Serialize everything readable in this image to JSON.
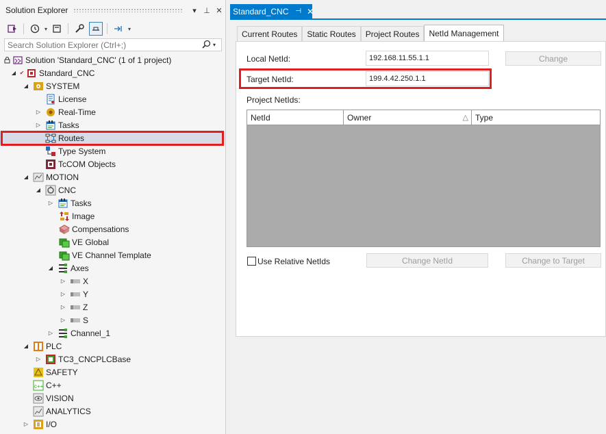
{
  "solution_explorer": {
    "title": "Solution Explorer",
    "title_buttons": [
      "▾",
      "⊥",
      "✕"
    ],
    "search": {
      "placeholder": "Search Solution Explorer (Ctrl+;)"
    },
    "tree": [
      {
        "label": "Solution 'Standard_CNC' (1 of 1 project)",
        "icon": "solution-icon"
      },
      {
        "label": "Standard_CNC",
        "icon": "project-icon"
      },
      {
        "label": "SYSTEM",
        "icon": "system-icon"
      },
      {
        "label": "License",
        "icon": "license-icon"
      },
      {
        "label": "Real-Time",
        "icon": "realtime-icon"
      },
      {
        "label": "Tasks",
        "icon": "tasks-icon"
      },
      {
        "label": "Routes",
        "icon": "routes-icon"
      },
      {
        "label": "Type System",
        "icon": "type-system-icon"
      },
      {
        "label": "TcCOM Objects",
        "icon": "tccom-icon"
      },
      {
        "label": "MOTION",
        "icon": "motion-icon"
      },
      {
        "label": "CNC",
        "icon": "cnc-icon"
      },
      {
        "label": "Tasks",
        "icon": "tasks-icon"
      },
      {
        "label": "Image",
        "icon": "image-icon"
      },
      {
        "label": "Compensations",
        "icon": "compensations-icon"
      },
      {
        "label": "VE Global",
        "icon": "ve-icon"
      },
      {
        "label": "VE Channel Template",
        "icon": "ve-icon"
      },
      {
        "label": "Axes",
        "icon": "axes-icon"
      },
      {
        "label": "X",
        "icon": "axis-icon"
      },
      {
        "label": "Y",
        "icon": "axis-icon"
      },
      {
        "label": "Z",
        "icon": "axis-icon"
      },
      {
        "label": "S",
        "icon": "axis-icon"
      },
      {
        "label": "Channel_1",
        "icon": "channel-icon"
      },
      {
        "label": "PLC",
        "icon": "plc-icon"
      },
      {
        "label": "TC3_CNCPLCBase",
        "icon": "plc-project-icon"
      },
      {
        "label": "SAFETY",
        "icon": "safety-icon"
      },
      {
        "label": "C++",
        "icon": "cpp-icon"
      },
      {
        "label": "VISION",
        "icon": "vision-icon"
      },
      {
        "label": "ANALYTICS",
        "icon": "analytics-icon"
      },
      {
        "label": "I/O",
        "icon": "io-icon"
      }
    ]
  },
  "document": {
    "tab": {
      "label": "Standard_CNC",
      "pin": "⊣",
      "close": "✕"
    },
    "tabs": [
      "Current Routes",
      "Static Routes",
      "Project Routes",
      "NetId Management"
    ],
    "local_netid": {
      "label": "Local NetId:",
      "value": "192.168.11.55.1.1"
    },
    "target_netid": {
      "label": "Target NetId:",
      "value": "199.4.42.250.1.1"
    },
    "change_button": "Change",
    "project_netids_label": "Project NetIds:",
    "columns": [
      "NetId",
      "Owner",
      "Type"
    ],
    "use_relative_label": "Use Relative NetIds",
    "change_netid_button": "Change NetId",
    "change_to_target_button": "Change to Target"
  },
  "colors": {
    "accent": "#007acc",
    "highlight": "#e02020",
    "selection": "#d6dbe6"
  }
}
